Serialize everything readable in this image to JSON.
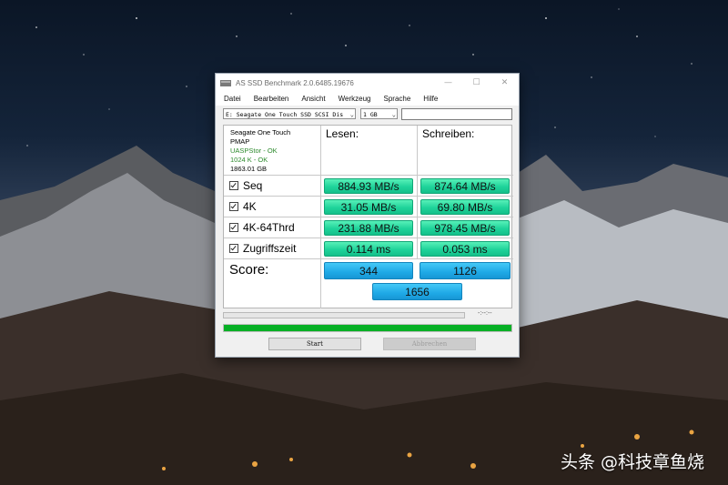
{
  "window": {
    "title": "AS SSD Benchmark 2.0.6485.19676",
    "minimize_glyph": "—",
    "maximize_glyph": "☐",
    "close_glyph": "✕"
  },
  "menu": [
    "Datei",
    "Bearbeiten",
    "Ansicht",
    "Werkzeug",
    "Sprache",
    "Hilfe"
  ],
  "toolbar": {
    "drive": "E: Seagate One Touch SSD SCSI Dis",
    "size": "1 GB",
    "text_value": ""
  },
  "drive_info": {
    "name": "Seagate One Touch",
    "line2": "PMAP",
    "driver_status": "UASPStor - OK",
    "alignment_status": "1024 K - OK",
    "capacity": "1863.01 GB"
  },
  "columns": {
    "read": "Lesen:",
    "write": "Schreiben:"
  },
  "rows": [
    {
      "label": "Seq",
      "read": "884.93 MB/s",
      "write": "874.64 MB/s",
      "checked": true
    },
    {
      "label": "4K",
      "read": "31.05 MB/s",
      "write": "69.80 MB/s",
      "checked": true
    },
    {
      "label": "4K-64Thrd",
      "read": "231.88 MB/s",
      "write": "978.45 MB/s",
      "checked": true
    },
    {
      "label": "Zugriffszeit",
      "read": "0.114 ms",
      "write": "0.053 ms",
      "checked": true
    }
  ],
  "score": {
    "label": "Score:",
    "read": "344",
    "write": "1126",
    "total": "1656"
  },
  "progress": {
    "time": "-:--:--",
    "main_fraction": 1.0
  },
  "buttons": {
    "start": "Start",
    "cancel": "Abbrechen"
  },
  "watermark": "头条 @科技章鱼烧",
  "colors": {
    "result_green": "#1fd39a",
    "score_blue": "#1fa9e6",
    "progress_green": "#06b025",
    "status_ok": "#2e8b2e"
  }
}
